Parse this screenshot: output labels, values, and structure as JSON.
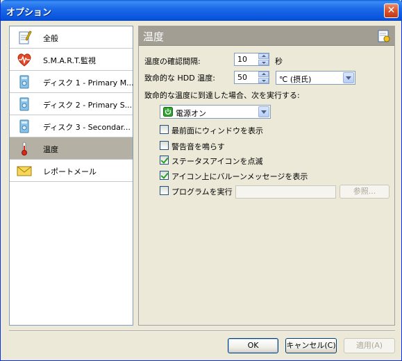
{
  "window": {
    "title": "オプション"
  },
  "sidebar": {
    "items": [
      {
        "label": "全般",
        "icon": "settings-document-icon"
      },
      {
        "label": "S.M.A.R.T.監視",
        "icon": "heart-monitor-icon"
      },
      {
        "label": "ディスク 1 - Primary M...",
        "icon": "disk-icon"
      },
      {
        "label": "ディスク 2 - Primary S...",
        "icon": "disk-icon"
      },
      {
        "label": "ディスク 3 - Secondar...",
        "icon": "disk-icon"
      },
      {
        "label": "温度",
        "icon": "thermometer-icon",
        "selected": true
      },
      {
        "label": "レポートメール",
        "icon": "envelope-icon"
      }
    ]
  },
  "panel": {
    "title": "温度",
    "check_interval": {
      "label": "温度の確認間隔:",
      "value": "10",
      "unit": "秒"
    },
    "critical_temp": {
      "label": "致命的な HDD 温度:",
      "value": "50",
      "unit_option": "℃ (摂氏)"
    },
    "action": {
      "label": "致命的な温度に到達した場合、次を実行する:",
      "value": "電源オン"
    },
    "checkboxes": [
      {
        "label": "最前面にウィンドウを表示",
        "checked": false
      },
      {
        "label": "警告音を鳴らす",
        "checked": false
      },
      {
        "label": "ステータスアイコンを点滅",
        "checked": true
      },
      {
        "label": "アイコン上にバルーンメッセージを表示",
        "checked": true
      },
      {
        "label": "プログラムを実行",
        "checked": false
      }
    ],
    "program_path": "",
    "browse_label": "参照..."
  },
  "buttons": {
    "ok": "OK",
    "cancel": "キャンセル(C)",
    "apply": "適用(A)"
  },
  "colors": {
    "titlebar": "#0855dd",
    "panel_header": "#a29e93",
    "selected_item": "#b4b0a4"
  }
}
